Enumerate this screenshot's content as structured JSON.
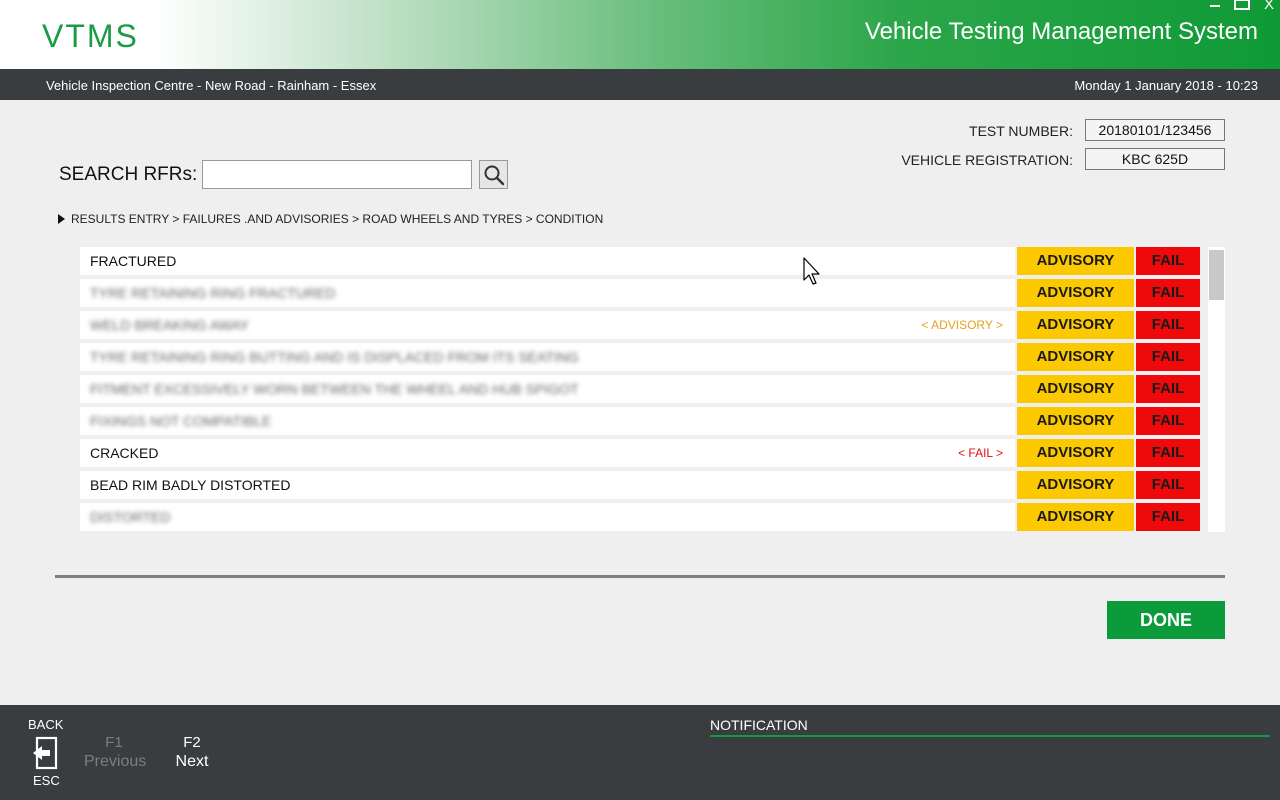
{
  "header": {
    "logo": "VTMS",
    "title": "Vehicle Testing Management System",
    "window_close": "X"
  },
  "infobar": {
    "location": "Vehicle Inspection Centre - New Road - Rainham - Essex",
    "datetime": "Monday 1 January 2018 - 10:23"
  },
  "test_info": {
    "test_number_label": "TEST NUMBER:",
    "test_number": "20180101/123456",
    "registration_label": "VEHICLE REGISTRATION:",
    "registration": "KBC 625D"
  },
  "search": {
    "label": "SEARCH RFRs:",
    "value": "",
    "icon": "search-icon"
  },
  "breadcrumb": {
    "path": "RESULTS ENTRY > FAILURES .AND ADVISORIES > ROAD WHEELS AND TYRES > CONDITION"
  },
  "rfr_rows": [
    {
      "label": "FRACTURED",
      "blurred": false,
      "tag": "",
      "tag_type": "",
      "advisory": "ADVISORY",
      "fail": "FAIL"
    },
    {
      "label": "TYRE RETAINING RING FRACTURED",
      "blurred": true,
      "tag": "",
      "tag_type": "",
      "advisory": "ADVISORY",
      "fail": "FAIL"
    },
    {
      "label": "WELD BREAKING AWAY",
      "blurred": true,
      "tag": "< ADVISORY >",
      "tag_type": "advisory",
      "advisory": "ADVISORY",
      "fail": "FAIL"
    },
    {
      "label": "TYRE RETAINING RING BUTTING AND IS DISPLACED FROM ITS SEATING",
      "blurred": true,
      "tag": "",
      "tag_type": "",
      "advisory": "ADVISORY",
      "fail": "FAIL"
    },
    {
      "label": "FITMENT EXCESSIVELY WORN BETWEEN THE WHEEL AND HUB SPIGOT",
      "blurred": true,
      "tag": "",
      "tag_type": "",
      "advisory": "ADVISORY",
      "fail": "FAIL"
    },
    {
      "label": "FIXINGS NOT COMPATIBLE",
      "blurred": true,
      "tag": "",
      "tag_type": "",
      "advisory": "ADVISORY",
      "fail": "FAIL"
    },
    {
      "label": "CRACKED",
      "blurred": false,
      "tag": "< FAIL >",
      "tag_type": "fail",
      "advisory": "ADVISORY",
      "fail": "FAIL"
    },
    {
      "label": "BEAD RIM BADLY DISTORTED",
      "blurred": false,
      "tag": "",
      "tag_type": "",
      "advisory": "ADVISORY",
      "fail": "FAIL"
    },
    {
      "label": "DISTORTED",
      "blurred": true,
      "tag": "",
      "tag_type": "",
      "advisory": "ADVISORY",
      "fail": "FAIL"
    }
  ],
  "done_button": "DONE",
  "footer": {
    "back_label": "BACK",
    "esc_label": "ESC",
    "f1_key": "F1",
    "f1_label": "Previous",
    "f2_key": "F2",
    "f2_label": "Next",
    "notification_label": "NOTIFICATION"
  },
  "colors": {
    "brand_green": "#0c9b3a",
    "advisory": "#fcc900",
    "fail": "#ee0a0a",
    "advisory_tag": "#e8a020",
    "fail_tag": "#e01010"
  }
}
